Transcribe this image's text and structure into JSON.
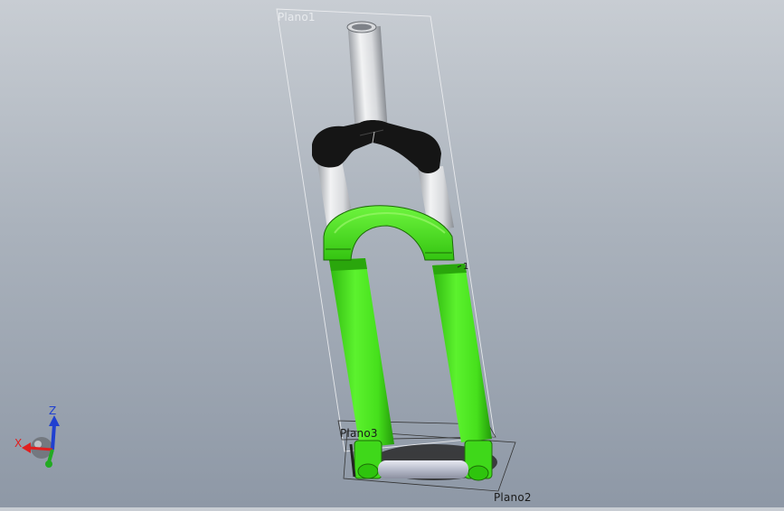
{
  "planes": {
    "plano1": "Plano1",
    "plano2": "Plano2",
    "plano3": "Plano3",
    "marker": "1"
  },
  "triad": {
    "x_label": "X",
    "z_label": "Z",
    "x_color": "#e02020",
    "y_color": "#22aa22",
    "z_color": "#2040d0"
  },
  "colors": {
    "lower_legs": "#44e61e",
    "crown": "#151515",
    "stanchions": "#e4e6e8",
    "axle": "#c9ccd6"
  },
  "icons": {
    "view_triad": "reference-triad-icon"
  }
}
